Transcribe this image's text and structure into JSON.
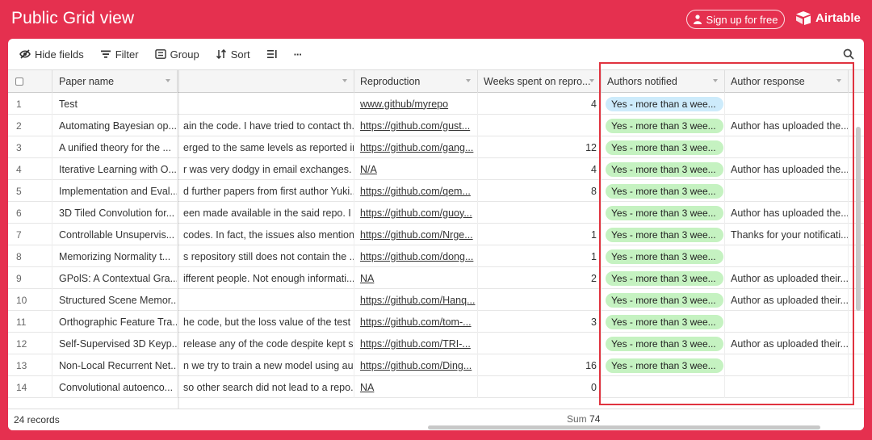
{
  "header": {
    "title": "Public Grid view",
    "signup_label": "Sign up for free",
    "brand": "Airtable",
    "brand_color": "#e5304f"
  },
  "toolbar": {
    "hide_fields": "Hide fields",
    "filter": "Filter",
    "group": "Group",
    "sort": "Sort",
    "more": "···"
  },
  "columns": [
    "Paper name",
    "Reproduction",
    "Weeks spent on repro...",
    "Authors notified",
    "Author response"
  ],
  "rows": [
    {
      "n": "1",
      "name": "Test",
      "notes": "",
      "repro": "www.github/myrepo",
      "weeks": "4",
      "notified": "Yes - more than a wee...",
      "notified_color": "blue",
      "response": ""
    },
    {
      "n": "2",
      "name": "Automating Bayesian op...",
      "notes": "ain the code. I have tried to contact th...",
      "repro": "https://github.com/gust...",
      "weeks": "",
      "notified": "Yes - more than 3 wee...",
      "notified_color": "green",
      "response": "Author has uploaded the..."
    },
    {
      "n": "3",
      "name": "A unified theory for the ...",
      "notes": "erged to the same levels as reported in...",
      "repro": "https://github.com/gang...",
      "weeks": "12",
      "notified": "Yes - more than 3 wee...",
      "notified_color": "green",
      "response": ""
    },
    {
      "n": "4",
      "name": "Iterative Learning with O...",
      "notes": "r was very dodgy in email exchanges. ...",
      "repro": "N/A",
      "weeks": "4",
      "notified": "Yes - more than 3 wee...",
      "notified_color": "green",
      "response": "Author has uploaded the..."
    },
    {
      "n": "5",
      "name": "Implementation and Eval...",
      "notes": "d further papers from first author Yuki...",
      "repro": "https://github.com/qem...",
      "weeks": "8",
      "notified": "Yes - more than 3 wee...",
      "notified_color": "green",
      "response": ""
    },
    {
      "n": "6",
      "name": "3D Tiled Convolution for...",
      "notes": "een made available in the said repo. I ...",
      "repro": "https://github.com/guoy...",
      "weeks": "",
      "notified": "Yes - more than 3 wee...",
      "notified_color": "green",
      "response": "Author has uploaded the..."
    },
    {
      "n": "7",
      "name": "Controllable Unsupervis...",
      "notes": "codes. In fact, the issues also mention...",
      "repro": "https://github.com/Nrge...",
      "weeks": "1",
      "notified": "Yes - more than 3 wee...",
      "notified_color": "green",
      "response": "Thanks for your notificati..."
    },
    {
      "n": "8",
      "name": "Memorizing Normality t...",
      "notes": "s repository still does not contain the ...",
      "repro": "https://github.com/dong...",
      "weeks": "1",
      "notified": "Yes - more than 3 wee...",
      "notified_color": "green",
      "response": ""
    },
    {
      "n": "9",
      "name": "GPolS: A Contextual Gra...",
      "notes": "ifferent people. Not enough informati...",
      "repro": "NA",
      "weeks": "2",
      "notified": "Yes - more than 3 wee...",
      "notified_color": "green",
      "response": "Author as uploaded their..."
    },
    {
      "n": "10",
      "name": "Structured Scene Memor...",
      "notes": "",
      "repro": "https://github.com/Hanq...",
      "weeks": "",
      "notified": "Yes - more than 3 wee...",
      "notified_color": "green",
      "response": "Author as uploaded their..."
    },
    {
      "n": "11",
      "name": "Orthographic Feature Tra...",
      "notes": "he code, but the loss value of the test s...",
      "repro": "https://github.com/tom-...",
      "weeks": "3",
      "notified": "Yes - more than 3 wee...",
      "notified_color": "green",
      "response": ""
    },
    {
      "n": "12",
      "name": "Self-Supervised 3D Keyp...",
      "notes": "release any of the code despite kept s...",
      "repro": "https://github.com/TRI-...",
      "weeks": "",
      "notified": "Yes - more than 3 wee...",
      "notified_color": "green",
      "response": "Author as uploaded their..."
    },
    {
      "n": "13",
      "name": "Non-Local Recurrent Net...",
      "notes": "n we try to train a new model using au...",
      "repro": "https://github.com/Ding...",
      "weeks": "16",
      "notified": "Yes - more than 3 wee...",
      "notified_color": "green",
      "response": ""
    },
    {
      "n": "14",
      "name": "Convolutional autoenco...",
      "notes": "so other search did not lead to a repo...",
      "repro": "NA",
      "weeks": "0",
      "notified": "",
      "notified_color": "",
      "response": ""
    }
  ],
  "footer": {
    "records": "24 records",
    "sum_label": "Sum",
    "sum_value": "74"
  }
}
